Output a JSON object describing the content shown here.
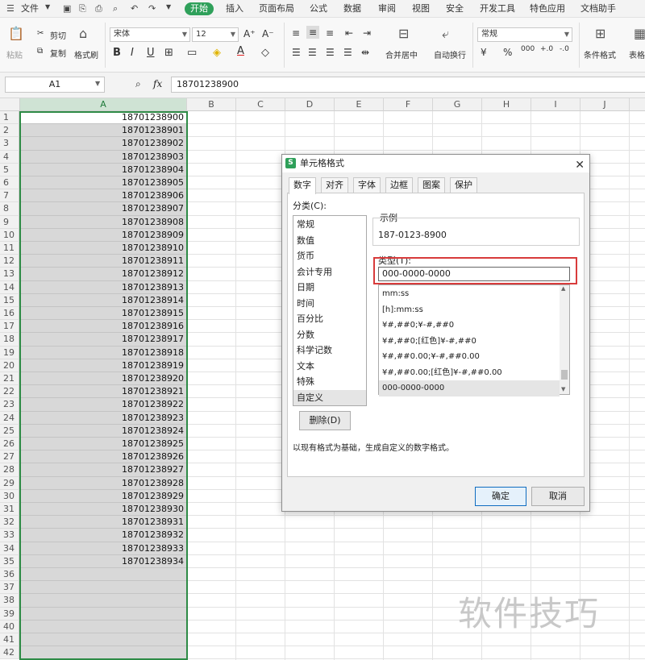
{
  "menubar": {
    "file": "文件",
    "tabs": [
      "开始",
      "插入",
      "页面布局",
      "公式",
      "数据",
      "审阅",
      "视图",
      "安全",
      "开发工具",
      "特色应用",
      "文档助手"
    ],
    "active": "开始"
  },
  "ribbon": {
    "paste": "粘贴",
    "cut": "剪切",
    "copy": "复制",
    "format_painter": "格式刷",
    "font_name": "宋体",
    "font_size": "12",
    "merge_center": "合并居中",
    "wrap_text": "自动换行",
    "number_format": "常规",
    "cond_format": "条件格式",
    "table_style": "表格"
  },
  "formula_bar": {
    "name_box": "A1",
    "fx": "fx",
    "value": "18701238900"
  },
  "sheet": {
    "columns": [
      "A",
      "B",
      "C",
      "D",
      "E",
      "F",
      "G",
      "H",
      "I",
      "J"
    ],
    "rows": [
      "1",
      "2",
      "3",
      "4",
      "5",
      "6",
      "7",
      "8",
      "9",
      "10",
      "11",
      "12",
      "13",
      "14",
      "15",
      "16",
      "17",
      "18",
      "19",
      "20",
      "21",
      "22",
      "23",
      "24",
      "25",
      "26",
      "27",
      "28",
      "29",
      "30",
      "31",
      "32",
      "33",
      "34",
      "35",
      "36",
      "37",
      "38",
      "39",
      "40",
      "41",
      "42"
    ],
    "values": [
      "18701238900",
      "18701238901",
      "18701238902",
      "18701238903",
      "18701238904",
      "18701238905",
      "18701238906",
      "18701238907",
      "18701238908",
      "18701238909",
      "18701238910",
      "18701238911",
      "18701238912",
      "18701238913",
      "18701238914",
      "18701238915",
      "18701238916",
      "18701238917",
      "18701238918",
      "18701238919",
      "18701238920",
      "18701238921",
      "18701238922",
      "18701238923",
      "18701238924",
      "18701238925",
      "18701238926",
      "18701238927",
      "18701238928",
      "18701238929",
      "18701238930",
      "18701238931",
      "18701238932",
      "18701238933",
      "18701238934"
    ]
  },
  "dialog": {
    "title": "单元格格式",
    "tabs": [
      "数字",
      "对齐",
      "字体",
      "边框",
      "图案",
      "保护"
    ],
    "active_tab": "数字",
    "category_label": "分类(C):",
    "categories": [
      "常规",
      "数值",
      "货币",
      "会计专用",
      "日期",
      "时间",
      "百分比",
      "分数",
      "科学记数",
      "文本",
      "特殊",
      "自定义"
    ],
    "selected_category": "自定义",
    "sample_label": "示例",
    "sample_value": "187-0123-8900",
    "type_label": "类型(T):",
    "type_value": "000-0000-0000",
    "formats": [
      "mm:ss",
      "[h]:mm:ss",
      "¥#,##0;¥-#,##0",
      "¥#,##0;[红色]¥-#,##0",
      "¥#,##0.00;¥-#,##0.00",
      "¥#,##0.00;[红色]¥-#,##0.00",
      "000-0000-0000"
    ],
    "selected_format": "000-0000-0000",
    "delete_button": "删除(D)",
    "hint": "以现有格式为基础，生成自定义的数字格式。",
    "ok_button": "确定",
    "cancel_button": "取消"
  },
  "watermark": "软件技巧"
}
